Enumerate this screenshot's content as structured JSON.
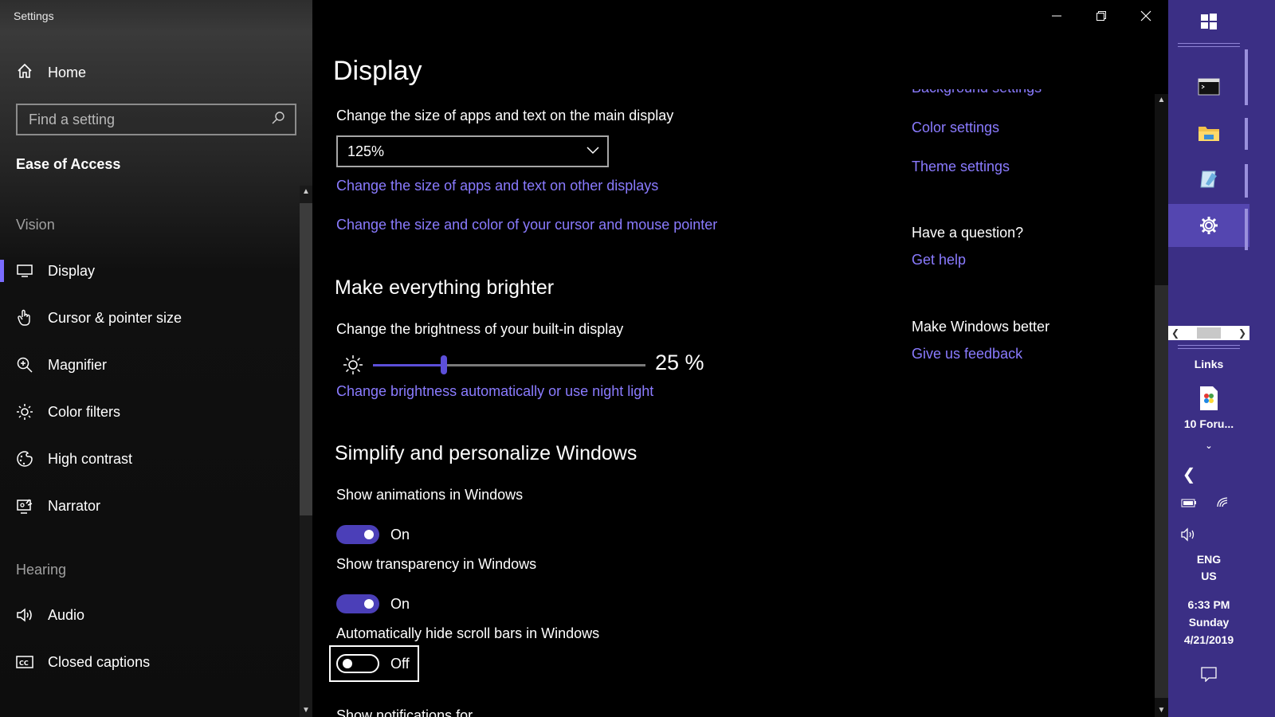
{
  "app": {
    "title": "Settings"
  },
  "sidebar": {
    "home_label": "Home",
    "search_placeholder": "Find a setting",
    "section_title": "Ease of Access",
    "groups": {
      "vision": "Vision",
      "hearing": "Hearing"
    },
    "items": [
      {
        "label": "Display",
        "icon": "monitor-icon",
        "active": true
      },
      {
        "label": "Cursor & pointer size",
        "icon": "cursor-hand-icon"
      },
      {
        "label": "Magnifier",
        "icon": "magnifier-icon"
      },
      {
        "label": "Color filters",
        "icon": "color-filters-icon"
      },
      {
        "label": "High contrast",
        "icon": "high-contrast-icon"
      },
      {
        "label": "Narrator",
        "icon": "narrator-icon"
      },
      {
        "label": "Audio",
        "icon": "speaker-icon"
      },
      {
        "label": "Closed captions",
        "icon": "closed-captions-icon"
      }
    ]
  },
  "main": {
    "title": "Display",
    "size_label": "Change the size of apps and text on the main display",
    "size_value": "125%",
    "link_other_displays": "Change the size of apps and text on other displays",
    "link_cursor": "Change the size and color of your cursor and mouse pointer",
    "brighter_heading": "Make everything brighter",
    "brightness_label": "Change the brightness of your built-in display",
    "brightness_value": "25 %",
    "brightness_fraction": 0.26,
    "link_night_light": "Change brightness automatically or use night light",
    "simplify_heading": "Simplify and personalize Windows",
    "toggles": [
      {
        "label": "Show animations in Windows",
        "state": "On"
      },
      {
        "label": "Show transparency in Windows",
        "state": "On"
      },
      {
        "label": "Automatically hide scroll bars in Windows",
        "state": "Off"
      }
    ],
    "cut_off_label": "Show notifications for"
  },
  "related": {
    "top_link_partial": "Background settings",
    "color_settings": "Color settings",
    "theme_settings": "Theme settings",
    "question_heading": "Have a question?",
    "get_help": "Get help",
    "better_heading": "Make Windows better",
    "feedback": "Give us feedback"
  },
  "taskbar": {
    "links_label": "Links",
    "pinned_item": "10 Foru...",
    "language": "ENG",
    "region": "US",
    "time": "6:33 PM",
    "day": "Sunday",
    "date": "4/21/2019"
  },
  "colors": {
    "accent": "#8a7bff",
    "toggle_on": "#4b3fb8",
    "taskbar": "#3b2f85"
  }
}
